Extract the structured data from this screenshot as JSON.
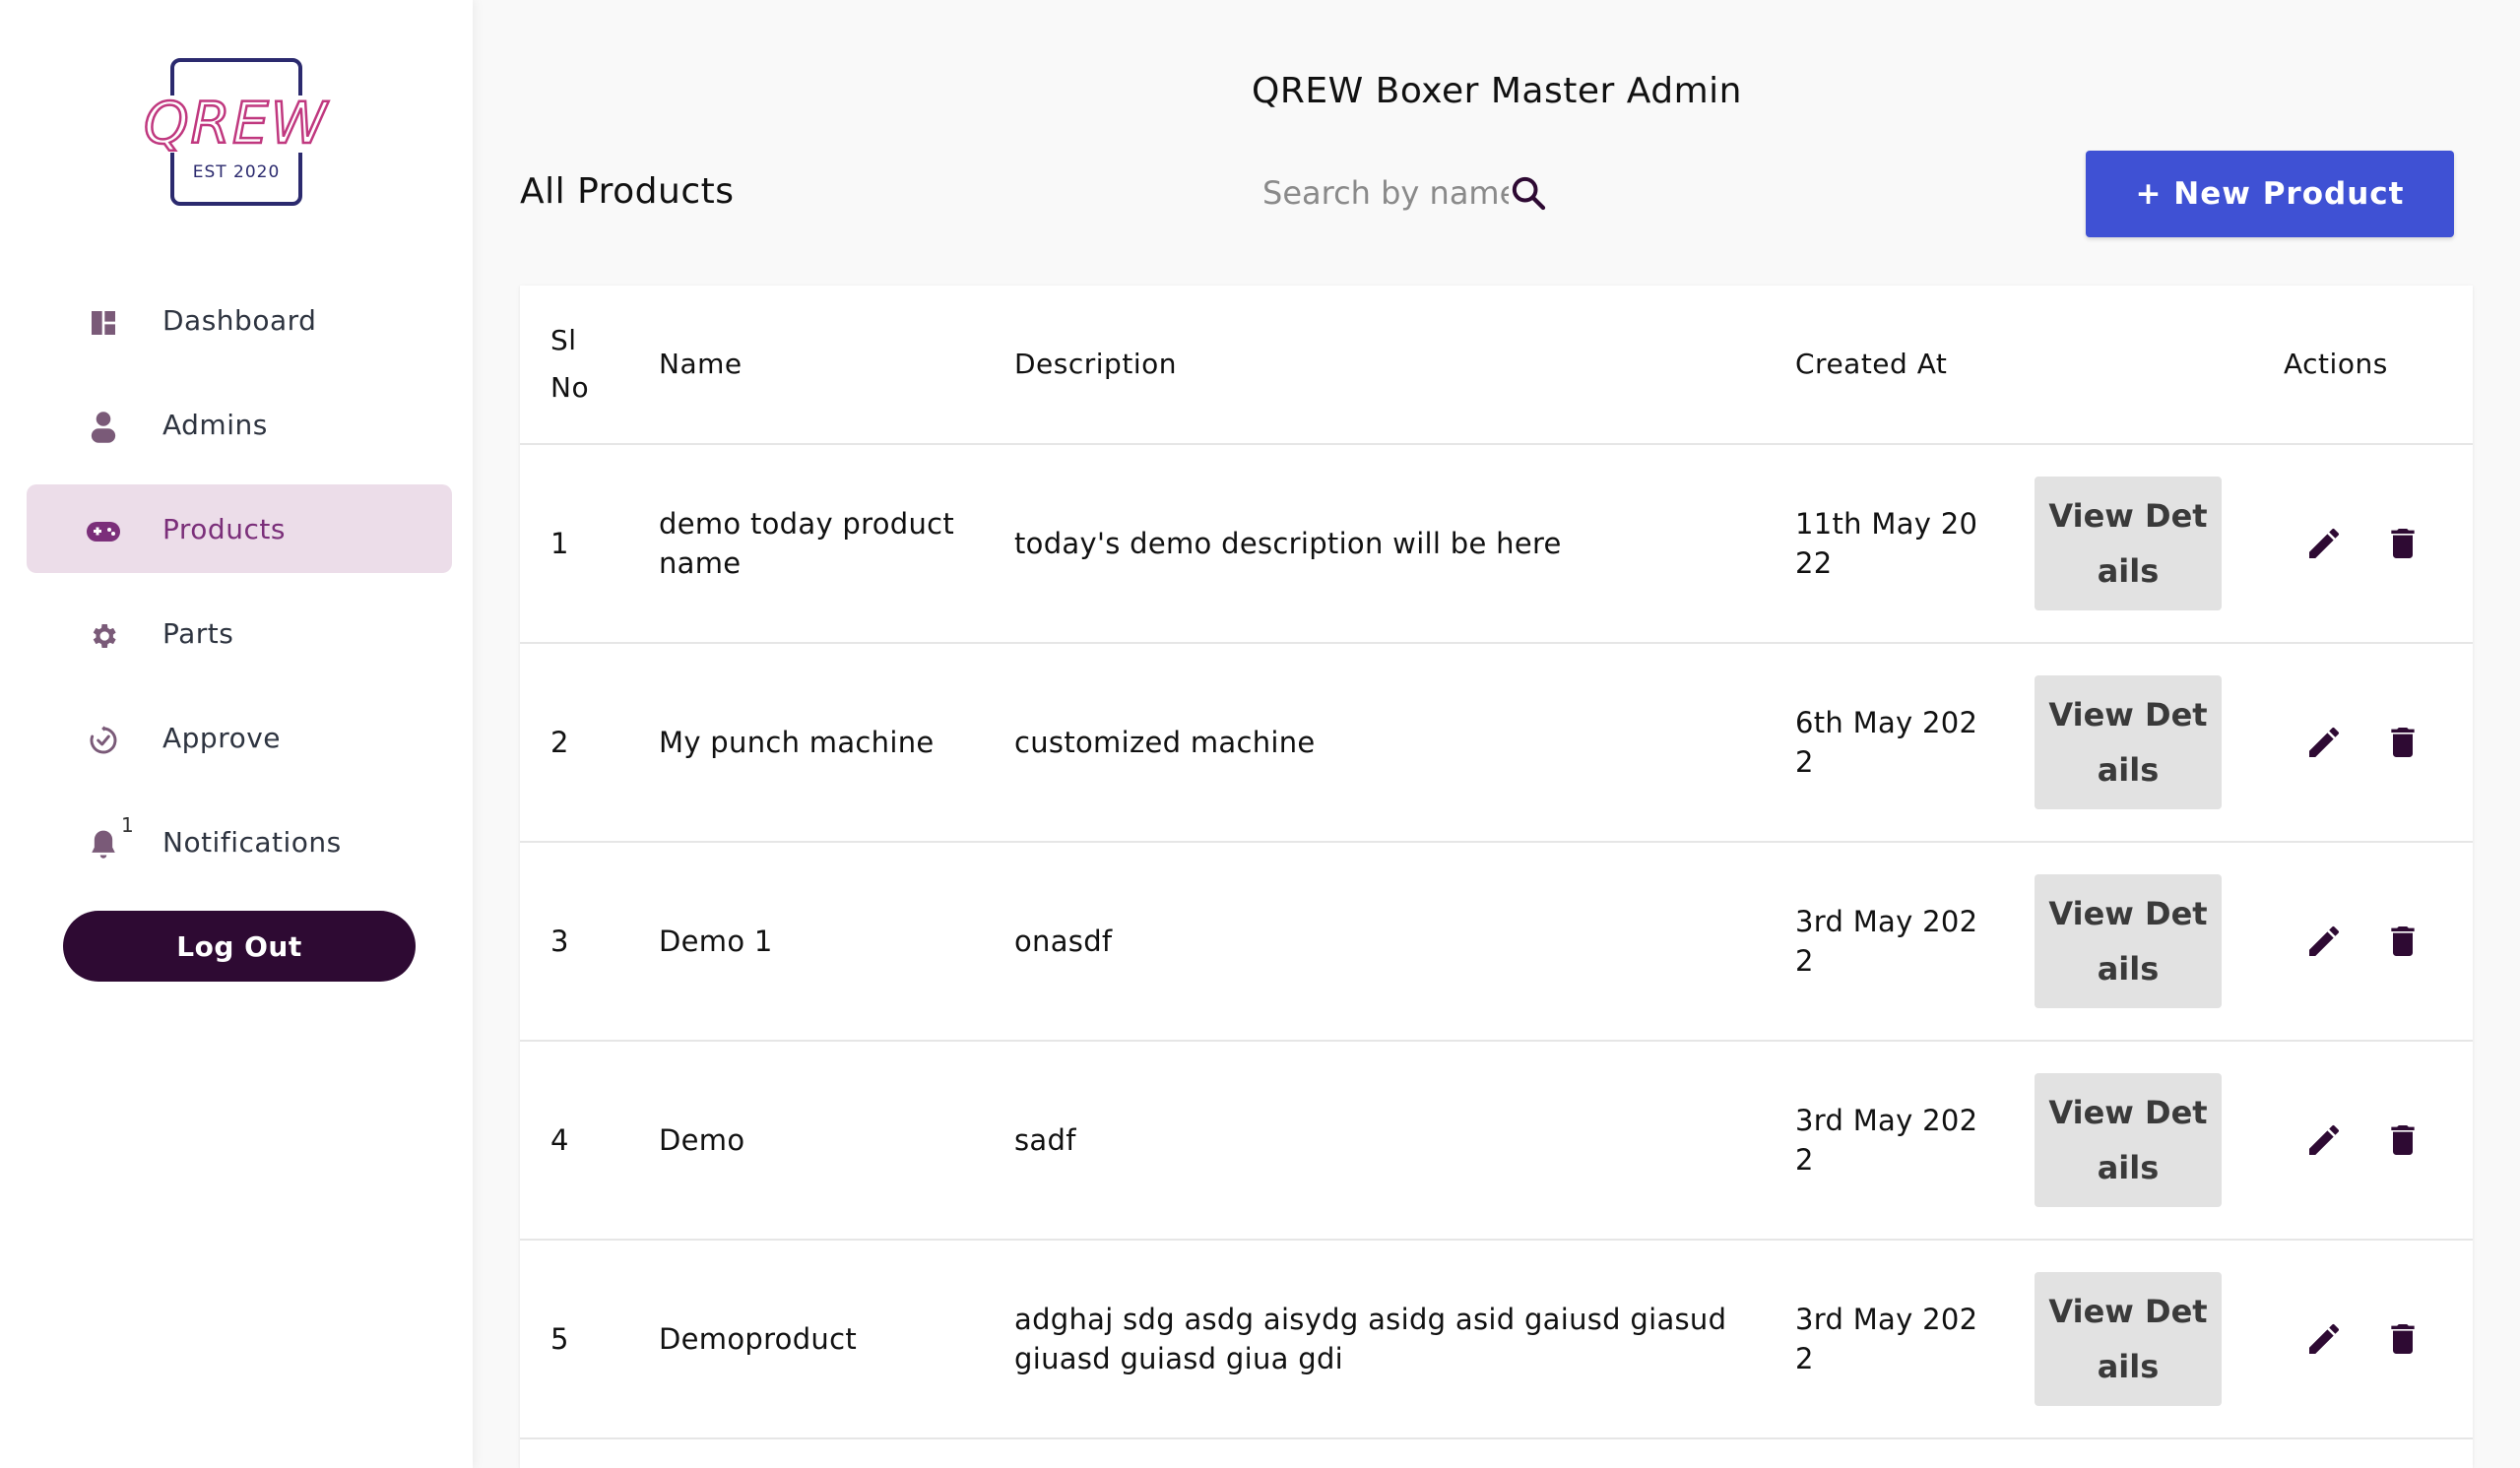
{
  "brand": {
    "logo_text": "QREW",
    "logo_est": "EST 2020"
  },
  "sidebar": {
    "items": [
      {
        "label": "Dashboard",
        "icon": "dashboard-icon"
      },
      {
        "label": "Admins",
        "icon": "person-icon"
      },
      {
        "label": "Products",
        "icon": "gamepad-icon",
        "active": true
      },
      {
        "label": "Parts",
        "icon": "gear-icon"
      },
      {
        "label": "Approve",
        "icon": "approve-icon"
      },
      {
        "label": "Notifications",
        "icon": "bell-icon",
        "badge": "1"
      }
    ],
    "logout_label": "Log Out"
  },
  "header": {
    "app_title": "QREW Boxer Master Admin",
    "page_title": "All Products",
    "search_placeholder": "Search by name",
    "new_button_label": "+ New Product"
  },
  "table": {
    "columns": {
      "sl": "Sl No",
      "name": "Name",
      "description": "Description",
      "created": "Created At",
      "actions": "Actions"
    },
    "view_label": "View Details",
    "rows": [
      {
        "sl": "1",
        "name": "demo today product name",
        "description": "today's demo description will be here",
        "created": "11th May 2022"
      },
      {
        "sl": "2",
        "name": "My punch machine",
        "description": "customized machine",
        "created": "6th May 2022"
      },
      {
        "sl": "3",
        "name": "Demo 1",
        "description": "onasdf",
        "created": "3rd May 2022"
      },
      {
        "sl": "4",
        "name": "Demo",
        "description": "sadf",
        "created": "3rd May 2022"
      },
      {
        "sl": "5",
        "name": "Demoproduct",
        "description": "adghaj sdg asdg aisydg asidg asid gaiusd giasud giuasd guiasd giua gdi",
        "created": "3rd May 2022"
      }
    ]
  },
  "colors": {
    "accent": "#3f51d4",
    "sidebar_active_bg": "#ecdde9",
    "sidebar_active_text": "#7b2f7a",
    "logout_bg": "#2e0a33",
    "icon_color": "#7a5a78",
    "action_icon_color": "#2e0a33"
  }
}
